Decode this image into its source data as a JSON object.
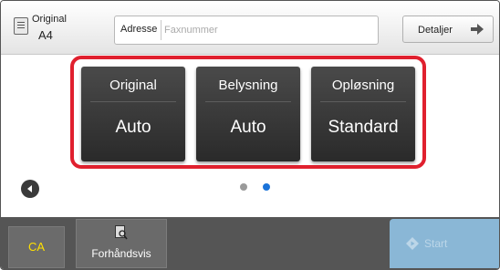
{
  "header": {
    "original_label": "Original",
    "original_size": "A4",
    "address_label": "Adresse",
    "address_placeholder": "Faxnummer",
    "address_value": "",
    "details_label": "Detaljer"
  },
  "settings": {
    "tiles": [
      {
        "title": "Original",
        "value": "Auto"
      },
      {
        "title": "Belysning",
        "value": "Auto"
      },
      {
        "title": "Opløsning",
        "value": "Standard"
      }
    ]
  },
  "pager": {
    "pages": 2,
    "active_page": 2,
    "active_color": "#1a73d9",
    "inactive_color": "#9a9a9a"
  },
  "footer": {
    "ca_label": "CA",
    "preview_label": "Forhåndsvis",
    "start_label": "Start"
  },
  "colors": {
    "highlight_border": "#e0202e",
    "ca_text": "#ffe000",
    "start_button": "#8ab7d6"
  },
  "icons": {
    "original": "original-document-icon",
    "details": "arrow-right-icon",
    "nav": "chevron-left-icon",
    "preview": "preview-magnifier-icon",
    "start": "start-diamond-icon"
  }
}
